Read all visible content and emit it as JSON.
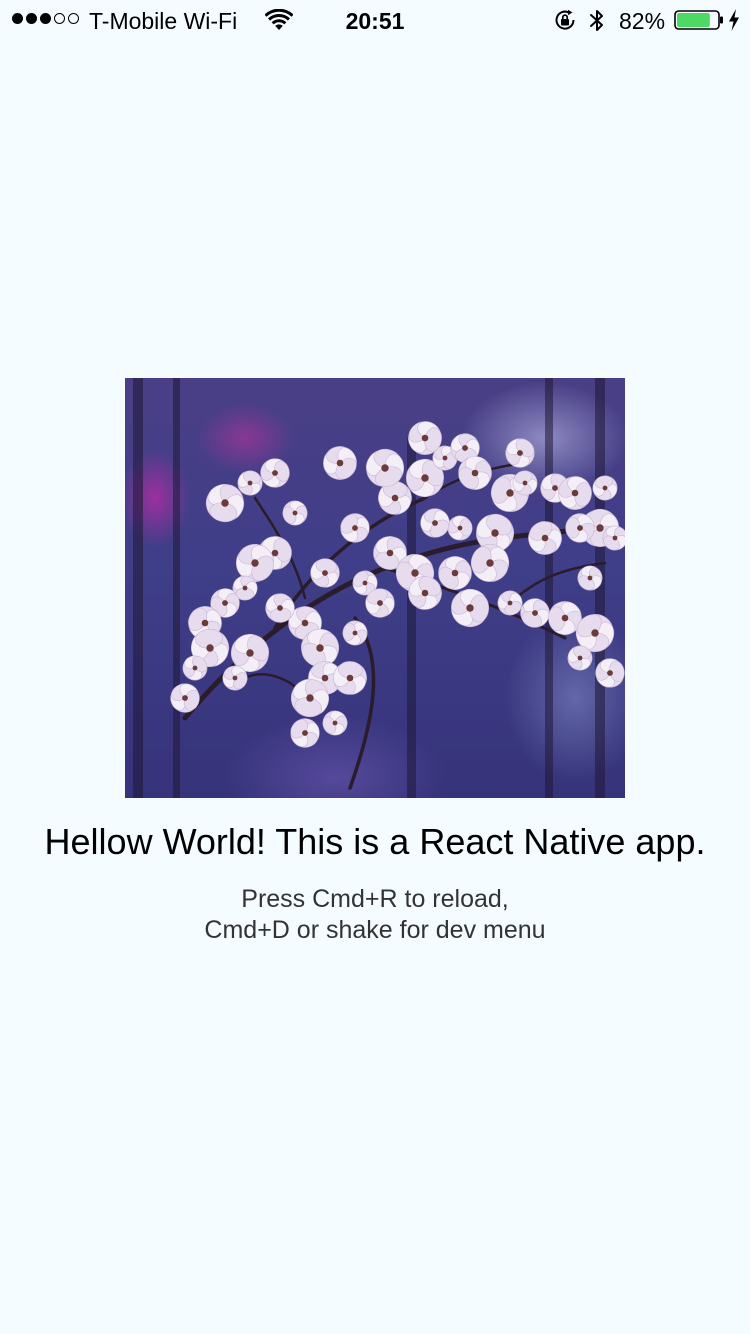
{
  "colors": {
    "background": "#F5FCFF",
    "text_primary": "#000000",
    "text_secondary": "#333333",
    "battery_fill": "#4CD964"
  },
  "status_bar": {
    "signal_strength": 3,
    "signal_max": 5,
    "carrier": "T-Mobile Wi-Fi",
    "time": "20:51",
    "battery_percent": "82%",
    "battery_level": 0.82,
    "icons": [
      "wifi-icon",
      "rotation-lock-icon",
      "bluetooth-icon",
      "battery-icon",
      "charging-bolt-icon"
    ]
  },
  "content": {
    "image": {
      "subject": "magnolia blossoms photo"
    },
    "headline": "Hellow World! This is a React Native app.",
    "instructions": [
      "Press Cmd+R to reload,",
      "Cmd+D or shake for dev menu"
    ]
  }
}
